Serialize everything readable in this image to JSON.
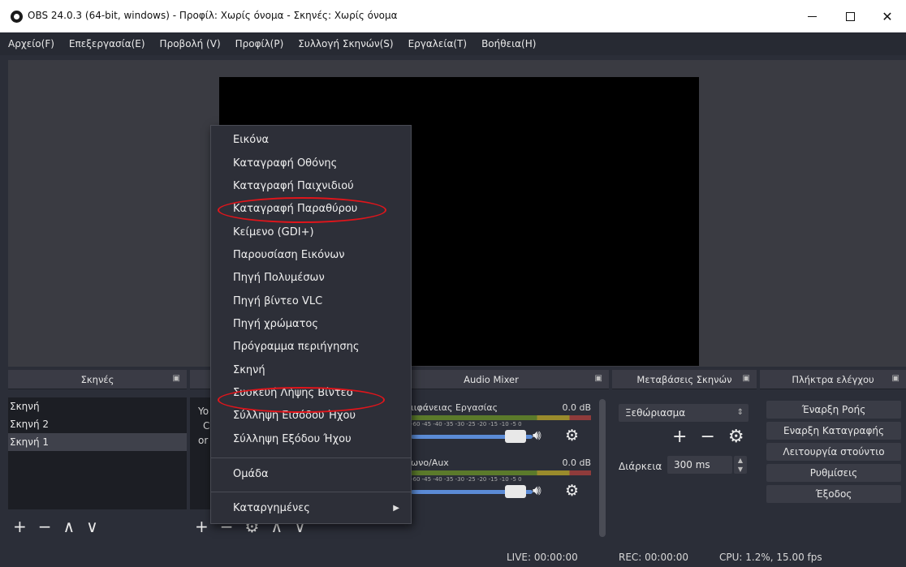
{
  "window": {
    "title": "OBS 24.0.3 (64-bit, windows) - Προφίλ: Χωρίς όνομα - Σκηνές: Χωρίς όνομα"
  },
  "menubar": {
    "items": [
      "Αρχείο(F)",
      "Επεξεργασία(E)",
      "Προβολή (V)",
      "Προφίλ(P)",
      "Συλλογή Σκηνών(S)",
      "Εργαλεία(T)",
      "Βοήθεια(H)"
    ]
  },
  "scenes": {
    "title": "Σκηνές",
    "items": [
      "Σκηνή",
      "Σκηνή 2",
      "Σκηνή 1"
    ],
    "selected_index": 2
  },
  "sources": {
    "partial_text": [
      "Yo",
      "C",
      "or"
    ]
  },
  "mixer": {
    "title": "Audio Mixer",
    "channels": [
      {
        "name": "ιιφάνειας Εργασίας",
        "db": "0.0 dB"
      },
      {
        "name": "ωνο/Aux",
        "db": "0.0 dB"
      }
    ],
    "ticks": "-60 -45 -40 -35 -30 -25 -20 -15 -10 -5 0"
  },
  "transitions": {
    "title": "Μεταβάσεις Σκηνών",
    "selected": "Ξεθώριασμα",
    "duration_label": "Διάρκεια",
    "duration_value": "300 ms"
  },
  "controls": {
    "title": "Πλήκτρα ελέγχου",
    "buttons": [
      "Έναρξη Ροής",
      "Εναρξη Καταγραφής",
      "Λειτουργία στούντιο",
      "Ρυθμίσεις",
      "Έξοδος"
    ]
  },
  "status": {
    "live": "LIVE: 00:00:00",
    "rec": "REC: 00:00:00",
    "cpu": "CPU: 1.2%, 15.00 fps"
  },
  "context_menu": {
    "items": [
      "Εικόνα",
      "Καταγραφή Οθόνης",
      "Καταγραφή Παιχνιδιού",
      "Καταγραφή Παραθύρου",
      "Κείμενο (GDI+)",
      "Παρουσίαση Εικόνων",
      "Πηγή Πολυμέσων",
      "Πηγή βίντεο VLC",
      "Πηγή χρώματος",
      "Πρόγραμμα περιήγησης",
      "Σκηνή",
      "Συσκευή Λήψης Βίντεο",
      "Σύλληψη Εισόδου Ήχου",
      "Σύλληψη Εξόδου Ήχου"
    ],
    "group": "Ομάδα",
    "deprecated": "Καταργημένες",
    "highlighted": [
      "Καταγραφή Παραθύρου",
      "Συσκευή Λήψης Βίντεο"
    ]
  },
  "colors": {
    "background": "#2b2e38",
    "highlight_ring": "#e0151b",
    "slider": "#5b8bd6"
  }
}
